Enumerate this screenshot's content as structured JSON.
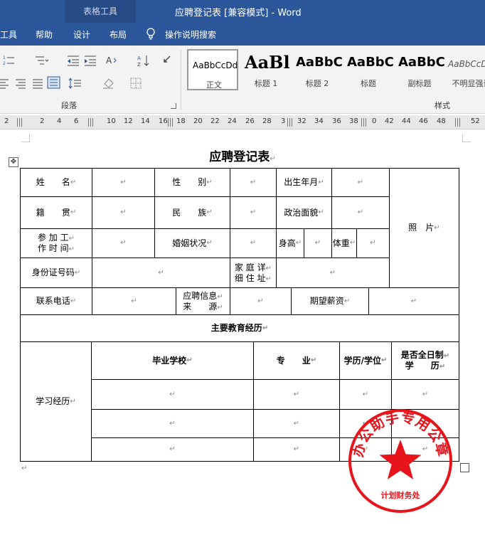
{
  "titlebar": {
    "context_tab_group": "表格工具",
    "document_title": "应聘登记表 [兼容模式]  -  Word"
  },
  "ribbon_tabs": [
    "工具",
    "帮助",
    "设计",
    "布局",
    "操作说明搜索"
  ],
  "ribbon": {
    "paragraph_group_label": "段落",
    "styles_group_label": "样式",
    "styles": [
      {
        "sample": "AaBbCcDd",
        "name": "正文"
      },
      {
        "sample": "AaBl",
        "name": "标题 1"
      },
      {
        "sample": "AaBbC",
        "name": "标题 2"
      },
      {
        "sample": "AaBbC",
        "name": "标题"
      },
      {
        "sample": "AaBbC",
        "name": "副标题"
      },
      {
        "sample": "AaBbCcDd",
        "name": "不明显强调"
      }
    ]
  },
  "ruler_numbers": [
    "2",
    "2",
    "4",
    "6",
    "10",
    "12",
    "14",
    "16",
    "18",
    "20",
    "22",
    "24",
    "26",
    "28",
    "3",
    "32",
    "34",
    "36",
    "38",
    "0",
    "42",
    "44",
    "46",
    "48",
    "52"
  ],
  "document": {
    "title": "应聘登记表",
    "para_mark": "↵",
    "form": {
      "name_label": "姓　　名",
      "gender_label": "性　　别",
      "birth_label": "出生年月",
      "photo_label": "照　片",
      "native_label": "籍　　贯",
      "ethnic_label": "民　　族",
      "political_label": "政治面貌",
      "work_start_label_1": "参 加 工",
      "work_start_label_2": "作 时 间",
      "marital_label": "婚姻状况",
      "height_label": "身高",
      "weight_label": "体重",
      "id_label": "身份证号码",
      "address_label_1": "家 庭 详",
      "address_label_2": "细 住 址",
      "phone_label": "联系电话",
      "source_label_1": "应聘信息",
      "source_label_2": "来　　源",
      "salary_label": "期望薪资",
      "education_header": "主要教育经历",
      "study_label": "学习经历",
      "school_header": "毕业学校",
      "major_header": "专　　业",
      "degree_header": "学历/学位",
      "fulltime_header_1": "是否全日制",
      "fulltime_header_2": "学　　历"
    }
  },
  "seal": {
    "text": "办公助手专用公章",
    "department": "计划财务处",
    "color": "#e8141b"
  }
}
